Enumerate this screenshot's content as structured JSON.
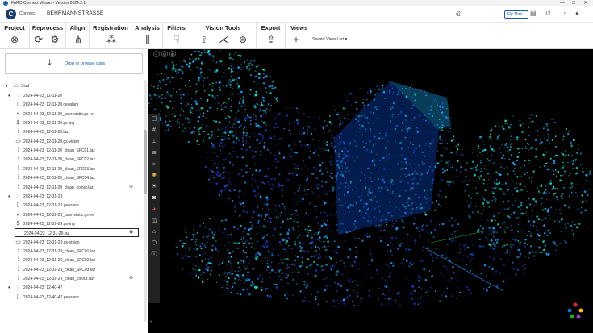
{
  "window": {
    "title": "FARO Connect Viewer - Version 2024.2.1",
    "controls": [
      "—",
      "□",
      "✕"
    ]
  },
  "header": {
    "logo_letter": "C",
    "connect_label": "Connect",
    "project_name": "BEHRMANNSTRASSE",
    "beta_label": "Fly Thro...",
    "icons": [
      "target-icon",
      "document-icon",
      "history-icon",
      "bell-icon",
      "user-icon"
    ]
  },
  "ribbon": {
    "groups": [
      {
        "title": "Project",
        "icons": [
          "close-circle-icon"
        ]
      },
      {
        "title": "Reprocess",
        "icons": [
          "reprocess-icon",
          "reprocess-settings-icon"
        ]
      },
      {
        "title": "Align",
        "icons": [
          "align-icon"
        ]
      },
      {
        "title": "Registration",
        "icons": [
          "registration-icon"
        ]
      },
      {
        "title": "Analysis",
        "icons": [
          "analysis-icon"
        ]
      },
      {
        "title": "Filters",
        "icons": [
          "filter-icon"
        ]
      },
      {
        "title": "Vision Tools",
        "icons": [
          "vision-tool-1-icon",
          "vision-tool-2-icon",
          "vision-tool-3-icon"
        ]
      },
      {
        "title": "Export",
        "icons": [
          "export-icon"
        ]
      },
      {
        "title": "Views",
        "icons": [
          "add-view-icon"
        ]
      }
    ],
    "saved_view_list": "Saved View List"
  },
  "sidebar": {
    "dropzone_text": "Drop or browse data",
    "root_label": "Stud",
    "tree": [
      {
        "label": "2024-04-23_12-11-20",
        "icon": "scan-group-icon",
        "level": 1,
        "group": true
      },
      {
        "label": "2024-04-23_12-11-20.geoslam",
        "icon": "file-icon",
        "level": 2
      },
      {
        "label": "2024-04-23_12-11-20_user-static.gs-ref",
        "icon": "globe-icon",
        "level": 2
      },
      {
        "label": "2024-04-23_12-11-20.gs-traj",
        "icon": "trajectory-icon",
        "level": 2
      },
      {
        "label": "2024-04-23_12-11-20.laz",
        "icon": "pointcloud-icon",
        "level": 2
      },
      {
        "label": "2024-04-23_12-11-20.gs-vision",
        "icon": "image-icon",
        "level": 2
      },
      {
        "label": "2024-04-23_12-11-20_clean_SFC01.laz",
        "icon": "pointcloud-icon",
        "level": 2
      },
      {
        "label": "2024-04-23_12-11-20_clean_SFC02.laz",
        "icon": "pointcloud-icon",
        "level": 2
      },
      {
        "label": "2024-04-23_12-11-20_clean_SFC03.laz",
        "icon": "pointcloud-icon",
        "level": 2
      },
      {
        "label": "2024-04-23_12-11-20_clean_SFC04.laz",
        "icon": "pointcloud-icon",
        "level": 2
      },
      {
        "label": "2024-04-23_12-11-20_clean_colour.laz",
        "icon": "pointcloud-icon",
        "level": 2,
        "eye": "hidden"
      },
      {
        "label": "2024-04-23_12-31-29",
        "icon": "scan-group-icon",
        "level": 1,
        "group": true
      },
      {
        "label": "2024-04-23_12-31-29.geoslam",
        "icon": "file-icon",
        "level": 2
      },
      {
        "label": "2024-04-23_12-31-29_user-static.gs-ref",
        "icon": "globe-icon",
        "level": 2
      },
      {
        "label": "2024-04-23_12-31-29.gs-traj",
        "icon": "trajectory-icon",
        "level": 2
      },
      {
        "label": "2024-04-23_12-31-29.laz",
        "icon": "pointcloud-icon",
        "level": 2,
        "selected": true,
        "eye": "visible"
      },
      {
        "label": "2024-04-23_12-31-29.gs-vision",
        "icon": "image-icon",
        "level": 2
      },
      {
        "label": "2024-04-23_12-31-29_clean_SFC01.laz",
        "icon": "pointcloud-icon",
        "level": 2
      },
      {
        "label": "2024-04-23_12-31-29_clean_SFC02.laz",
        "icon": "pointcloud-icon",
        "level": 2
      },
      {
        "label": "2024-04-23_12-31-29_clean_SFC03.laz",
        "icon": "pointcloud-icon",
        "level": 2
      },
      {
        "label": "2024-04-23_12-31-29_clean_colour.laz",
        "icon": "pointcloud-icon",
        "level": 2,
        "eye": "hidden"
      },
      {
        "label": "2024-04-23_12-40-47",
        "icon": "scan-group-icon",
        "level": 1,
        "group": true
      },
      {
        "label": "2024-04-23_12-40-47.geoslam",
        "icon": "file-icon",
        "level": 2
      }
    ],
    "collapse_label": "«"
  },
  "viewer": {
    "top_controls": [
      "−",
      "⊙",
      "⊕"
    ],
    "tools": [
      "box-select-icon",
      "grid-icon",
      "measure-icon",
      "layers-icon",
      "lightbulb-icon",
      "color-wheel-icon",
      "sun-icon",
      "camera-icon",
      "palette-icon",
      "cube-icon",
      "home-icon",
      "clipping-icon",
      "info-icon"
    ],
    "colors": {
      "bg": "#000000",
      "cloud_high": "#14e6c8",
      "cloud_mid": "#1aa0ff",
      "cloud_low": "#1b3fd8"
    }
  }
}
